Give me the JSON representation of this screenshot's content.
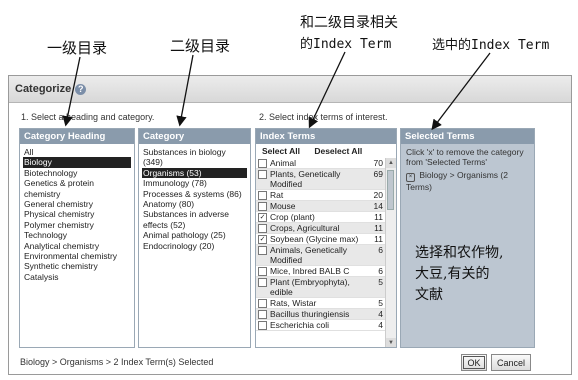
{
  "annotations": {
    "level1": "一级目录",
    "level2": "二级目录",
    "related_line1": "和二级目录相关",
    "related_line2": "的Index Term",
    "selected_term": "选中的Index Term",
    "note_line1": "选择和农作物,",
    "note_line2": "大豆,有关的",
    "note_line3": "文献"
  },
  "dialog": {
    "title": "Categorize",
    "help_icon": "?",
    "step1": "1. Select a heading and category.",
    "step2": "2. Select index terms of interest.",
    "status": "Biology > Organisms > 2 Index Term(s) Selected",
    "ok_label": "OK",
    "cancel_label": "Cancel"
  },
  "category_heading": {
    "title": "Category Heading",
    "items": [
      "All",
      "Biology",
      "Biotechnology",
      "Genetics & protein chemistry",
      "General chemistry",
      "Physical chemistry",
      "Polymer chemistry",
      "Technology",
      "Analytical chemistry",
      "Environmental chemistry",
      "Synthetic chemistry",
      "Catalysis"
    ],
    "selected_index": 1
  },
  "category": {
    "title": "Category",
    "items": [
      "Substances in biology (349)",
      "Organisms (53)",
      "Immunology (78)",
      "Processes & systems (86)",
      "Anatomy (80)",
      "Substances in adverse effects (52)",
      "Animal pathology (25)",
      "Endocrinology (20)"
    ],
    "selected_index": 1
  },
  "index_terms": {
    "title": "Index Terms",
    "select_all": "Select All",
    "deselect_all": "Deselect All",
    "rows": [
      {
        "name": "Animal",
        "count": "70",
        "checked": false
      },
      {
        "name": "Plants, Genetically Modified",
        "count": "69",
        "checked": false
      },
      {
        "name": "Rat",
        "count": "20",
        "checked": false
      },
      {
        "name": "Mouse",
        "count": "14",
        "checked": false
      },
      {
        "name": "Crop (plant)",
        "count": "11",
        "checked": true
      },
      {
        "name": "Crops, Agricultural",
        "count": "11",
        "checked": false
      },
      {
        "name": "Soybean (Glycine max)",
        "count": "11",
        "checked": true
      },
      {
        "name": "Animals, Genetically Modified",
        "count": "6",
        "checked": false
      },
      {
        "name": "Mice, Inbred BALB C",
        "count": "6",
        "checked": false
      },
      {
        "name": "Plant (Embryophyta), edible",
        "count": "5",
        "checked": false
      },
      {
        "name": "Rats, Wistar",
        "count": "5",
        "checked": false
      },
      {
        "name": "Bacillus thuringiensis",
        "count": "4",
        "checked": false
      },
      {
        "name": "Escherichia coli",
        "count": "4",
        "checked": false
      }
    ]
  },
  "selected_terms": {
    "title": "Selected Terms",
    "hint": "Click 'x' to remove the category from 'Selected Terms'",
    "entry": "Biology > Organisms (2 Terms)"
  }
}
